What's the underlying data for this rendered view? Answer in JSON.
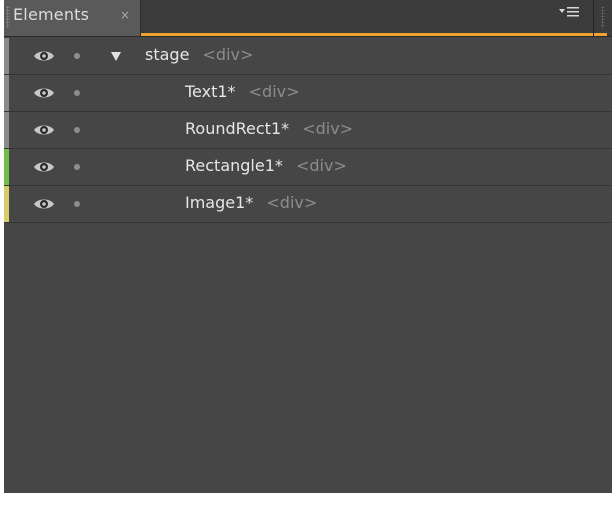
{
  "panel": {
    "tab_title": "Elements",
    "tab_close_glyph": "×",
    "menu_icon": "panel-menu-icon"
  },
  "colors": {
    "panel_bg": "#464646",
    "tab_accent": "#f0a32e",
    "row_border": "#343434",
    "name_text": "#e6e6e6",
    "tag_text": "#8c8c8c",
    "stripe_gray": "#8a8a8a",
    "stripe_green": "#6fbf4a",
    "stripe_yellow": "#d4cd6a"
  },
  "elements": [
    {
      "name": "stage",
      "tag": "<div>",
      "expanded": true,
      "stripe": "#8a8a8a",
      "visible_icon": "eye-icon"
    },
    {
      "name": "Text1*",
      "tag": "<div>",
      "stripe": "#8a8a8a",
      "visible_icon": "eye-icon"
    },
    {
      "name": "RoundRect1*",
      "tag": "<div>",
      "stripe": "#8a8a8a",
      "visible_icon": "eye-icon"
    },
    {
      "name": "Rectangle1*",
      "tag": "<div>",
      "stripe": "#6fbf4a",
      "visible_icon": "eye-icon"
    },
    {
      "name": "Image1*",
      "tag": "<div>",
      "stripe": "#d4cd6a",
      "visible_icon": "eye-icon"
    }
  ]
}
